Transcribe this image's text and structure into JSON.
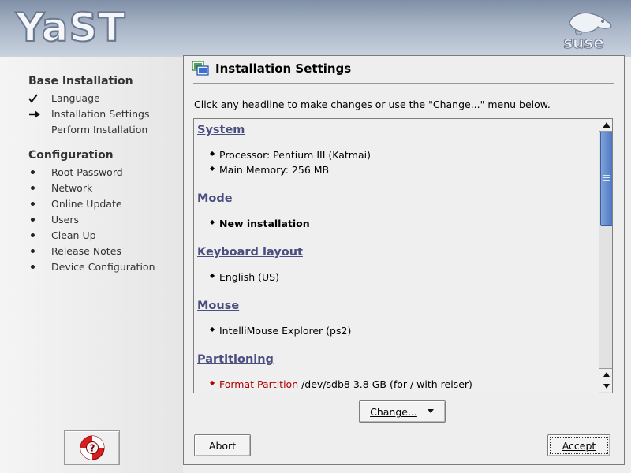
{
  "branding": {
    "app_logo": "YaST",
    "vendor_logo": "suse"
  },
  "sidebar": {
    "sections": [
      {
        "heading": "Base Installation",
        "items": [
          {
            "label": "Language",
            "state": "done",
            "icon": "checkmark-icon"
          },
          {
            "label": "Installation Settings",
            "state": "current",
            "icon": "arrow-right-icon"
          },
          {
            "label": "Perform Installation",
            "state": "pending",
            "icon": "bullet-icon"
          }
        ]
      },
      {
        "heading": "Configuration",
        "items": [
          {
            "label": "Root Password",
            "icon": "bullet-icon"
          },
          {
            "label": "Network",
            "icon": "bullet-icon"
          },
          {
            "label": "Online Update",
            "icon": "bullet-icon"
          },
          {
            "label": "Users",
            "icon": "bullet-icon"
          },
          {
            "label": "Clean Up",
            "icon": "bullet-icon"
          },
          {
            "label": "Release Notes",
            "icon": "bullet-icon"
          },
          {
            "label": "Device Configuration",
            "icon": "bullet-icon"
          }
        ]
      }
    ],
    "help_button_icon": "lifebuoy-help-icon"
  },
  "main": {
    "title": "Installation Settings",
    "title_icon": "installation-settings-icon",
    "instruction": "Click any headline to make changes or use the \"Change...\" menu below.",
    "sections": [
      {
        "heading": "System",
        "items": [
          "Processor: Pentium III (Katmai)",
          "Main Memory: 256 MB"
        ]
      },
      {
        "heading": "Mode",
        "items": [
          "New installation"
        ]
      },
      {
        "heading": "Keyboard layout",
        "items": [
          "English (US)"
        ]
      },
      {
        "heading": "Mouse",
        "items": [
          "IntelliMouse Explorer (ps2)"
        ]
      },
      {
        "heading": "Partitioning",
        "items": [
          {
            "action": "Format Partition",
            "rest": " /dev/sdb8 3.8 GB (for / with reiser)"
          }
        ]
      }
    ],
    "buttons": {
      "change": "Change...",
      "abort": "Abort",
      "accept": "Accept"
    }
  },
  "colors": {
    "section_link": "#4a4f80",
    "warning_text": "#b00000",
    "scroll_thumb": "#4e78c2"
  }
}
